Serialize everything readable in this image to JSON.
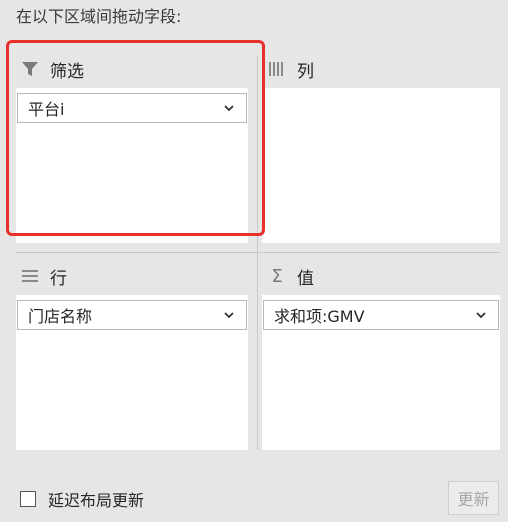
{
  "instruction": "在以下区域间拖动字段:",
  "zones": {
    "filters": {
      "title": "筛选",
      "icon": "filter-icon",
      "field": "平台i"
    },
    "columns": {
      "title": "列",
      "icon": "columns-icon"
    },
    "rows": {
      "title": "行",
      "icon": "rows-icon",
      "field": "门店名称"
    },
    "values": {
      "title": "值",
      "icon": "sigma-icon",
      "field": "求和项:GMV"
    }
  },
  "footer": {
    "defer_label": "延迟布局更新",
    "defer_checked": false,
    "update_label": "更新"
  },
  "colors": {
    "highlight": "#e8312c",
    "panel_bg": "#e6e6e6",
    "well_bg": "#ffffff"
  }
}
